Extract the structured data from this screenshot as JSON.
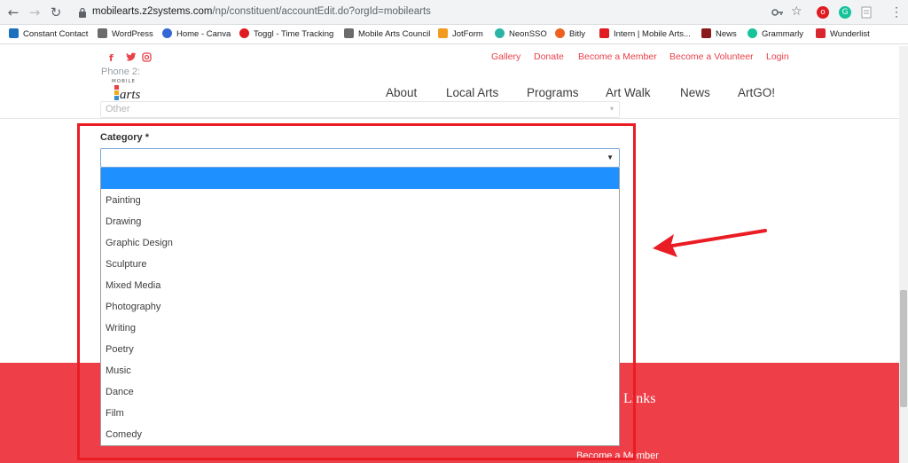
{
  "browser": {
    "url_host": "mobilearts.z2systems.com",
    "url_path": "/np/constituent/accountEdit.do?orgId=mobilearts",
    "bookmarks": [
      {
        "label": "Constant Contact",
        "color": "#1f6fbf"
      },
      {
        "label": "WordPress",
        "color": "#6b6b6b"
      },
      {
        "label": "Home - Canva",
        "color": "#3367d6"
      },
      {
        "label": "Toggl - Time Tracking",
        "color": "#e01b22"
      },
      {
        "label": "Mobile Arts Council",
        "color": "#6b6b6b"
      },
      {
        "label": "JotForm",
        "color": "#f29b1e"
      },
      {
        "label": "NeonSSO",
        "color": "#2bb3a3"
      },
      {
        "label": "Bitly",
        "color": "#ee6123"
      },
      {
        "label": "Intern | Mobile Arts...",
        "color": "#e01b22"
      },
      {
        "label": "News",
        "color": "#8b1a1a"
      },
      {
        "label": "Grammarly",
        "color": "#15c39a"
      },
      {
        "label": "Wunderlist",
        "color": "#d8262f"
      }
    ]
  },
  "site": {
    "social": [
      "f",
      "t",
      "ig"
    ],
    "top_links": [
      "Gallery",
      "Donate",
      "Become a Member",
      "Become a Volunteer",
      "Login"
    ],
    "nav": [
      "About",
      "Local Arts",
      "Programs",
      "Art Walk",
      "News",
      "ArtGO!"
    ],
    "ghost_label": "Phone 2:",
    "ghost_select_value": "Other",
    "logo_text": "arts"
  },
  "form": {
    "category_label": "Category *",
    "category_value": "",
    "options": [
      "",
      "Painting",
      "Drawing",
      "Graphic Design",
      "Sculpture",
      "Mixed Media",
      "Photography",
      "Writing",
      "Poetry",
      "Music",
      "Dance",
      "Film",
      "Comedy"
    ]
  },
  "footer": {
    "links_heading": "Links",
    "member_link": "Become a Member"
  },
  "colors": {
    "brand_red": "#ee3e48",
    "annotation_red": "#ea1c24",
    "selection_blue": "#1e90ff"
  }
}
